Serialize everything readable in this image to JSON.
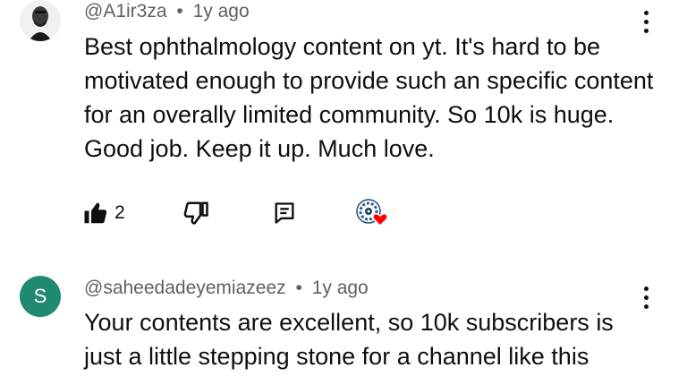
{
  "comments": [
    {
      "author": "@A1ir3za",
      "separator": "•",
      "time": "1y ago",
      "text": "Best ophthalmology content on yt. It's hard to be motivated enough to provide such an specific content for an overally limited community. So 10k is huge. Good job. Keep it up. Much love.",
      "likes": "2",
      "icons": {
        "like": "thumb-up-filled-icon",
        "dislike": "thumb-down-icon",
        "reply": "reply-comment-icon",
        "heart": "creator-heart-icon",
        "more": "more-vertical-icon"
      }
    },
    {
      "author": "@saheedadeyemiazeez",
      "avatar_letter": "S",
      "avatar_color": "#1f8a70",
      "separator": "•",
      "time": "1y ago",
      "text": "Your contents are excellent, so 10k subscribers is just a little stepping stone for a channel like this",
      "icons": {
        "more": "more-vertical-icon"
      }
    }
  ],
  "colors": {
    "text": "#0f0f0f",
    "meta": "#606060",
    "heart": "#ff0000"
  }
}
